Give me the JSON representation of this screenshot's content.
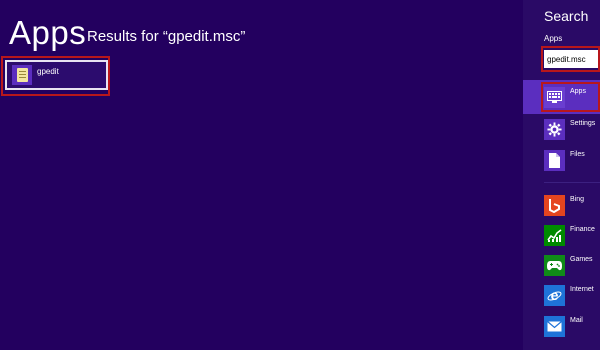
{
  "main": {
    "title": "Apps",
    "results_for": "Results for “gpedit.msc”",
    "results": [
      {
        "label": "gpedit",
        "icon": "document-icon"
      }
    ]
  },
  "charm": {
    "title": "Search",
    "scope_label": "Apps",
    "search_value": "gpedit.msc",
    "filters": [
      {
        "label": "Apps",
        "icon": "apps-icon",
        "selected": true
      },
      {
        "label": "Settings",
        "icon": "gear-icon",
        "selected": false
      },
      {
        "label": "Files",
        "icon": "file-icon",
        "selected": false
      }
    ],
    "app_filters": [
      {
        "label": "Bing",
        "icon": "bing-icon"
      },
      {
        "label": "Finance",
        "icon": "finance-icon"
      },
      {
        "label": "Games",
        "icon": "games-icon"
      },
      {
        "label": "Internet",
        "icon": "internet-explorer-icon"
      },
      {
        "label": "Mail",
        "icon": "mail-icon"
      }
    ]
  },
  "colors": {
    "background": "#23005f",
    "charm_background": "#2a0a66",
    "selected_filter": "#5b2ebf",
    "highlight_box": "#b8171b",
    "bing_tile": "#e5451f",
    "finance_tile": "#008a00",
    "games_tile": "#108a18",
    "internet_tile": "#1e73d8",
    "mail_tile": "#1e73d8"
  }
}
